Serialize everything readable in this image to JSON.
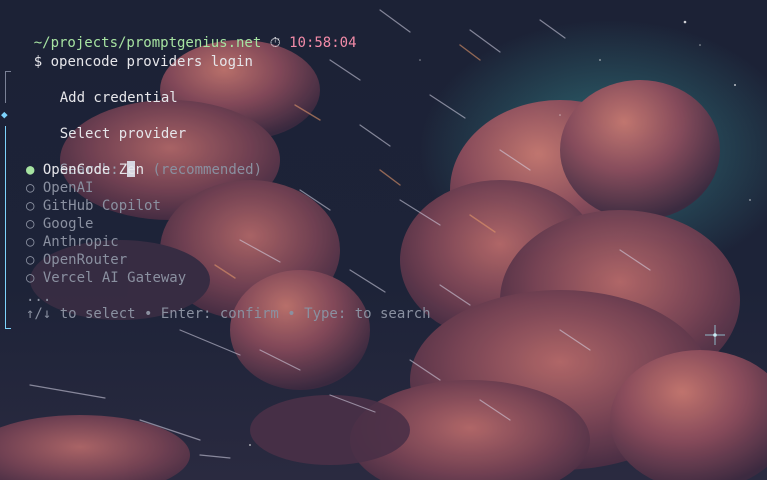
{
  "prompt": {
    "path": "~/projects/promptgenius.net",
    "clock_icon": "clock-icon",
    "time": "10:58:04",
    "symbol": "$",
    "command": "opencode providers login"
  },
  "wizard": {
    "step1_label": "Add credential",
    "step2_label": "Select provider",
    "search_label": "Search:",
    "search_value": "",
    "options": [
      {
        "name": "OpenCode Zen",
        "note": "(recommended)",
        "selected": true
      },
      {
        "name": "OpenAI",
        "note": "",
        "selected": false
      },
      {
        "name": "GitHub Copilot",
        "note": "",
        "selected": false
      },
      {
        "name": "Google",
        "note": "",
        "selected": false
      },
      {
        "name": "Anthropic",
        "note": "",
        "selected": false
      },
      {
        "name": "OpenRouter",
        "note": "",
        "selected": false
      },
      {
        "name": "Vercel AI Gateway",
        "note": "",
        "selected": false
      }
    ],
    "more": "...",
    "hint": "↑/↓ to select • Enter: confirm • Type: to search"
  },
  "colors": {
    "path": "#a6e3a1",
    "time": "#f38ba8",
    "accent": "#7dd3fc",
    "selected_dot": "#a6e3a1"
  }
}
